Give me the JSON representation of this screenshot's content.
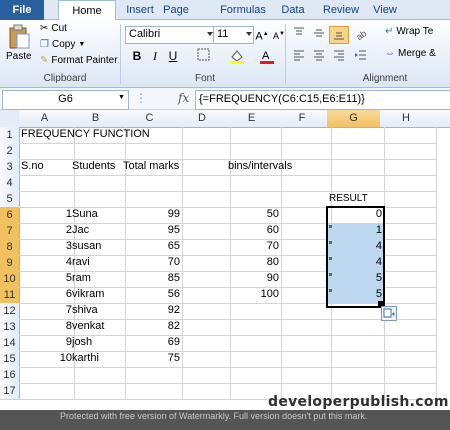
{
  "ribbon": {
    "tabs": [
      "File",
      "Home",
      "Insert",
      "Page Layout",
      "Formulas",
      "Data",
      "Review",
      "View"
    ],
    "clipboard": {
      "paste": "Paste",
      "cut": "Cut",
      "copy": "Copy",
      "format_painter": "Format Painter",
      "group": "Clipboard"
    },
    "font": {
      "name": "Calibri",
      "size": "11",
      "group": "Font"
    },
    "alignment": {
      "wrap": "Wrap Te",
      "merge": "Merge &",
      "group": "Alignment"
    }
  },
  "formula_bar": {
    "name_box": "G6",
    "fx": "fx",
    "formula": "{=FREQUENCY(C6:C15,E6:E11)}"
  },
  "columns": [
    "A",
    "B",
    "C",
    "D",
    "E",
    "F",
    "G",
    "H"
  ],
  "rows": [
    "1",
    "2",
    "3",
    "4",
    "5",
    "6",
    "7",
    "8",
    "9",
    "10",
    "11",
    "12",
    "13",
    "14",
    "15",
    "16",
    "17"
  ],
  "sheet": {
    "title": "FREQUENCY FUNCTION",
    "hdr_sno": "S.no",
    "hdr_students": "Students",
    "hdr_total": "Total marks",
    "hdr_bins": "bins/intervals",
    "result_label": "RESULT",
    "records": [
      {
        "sno": "1",
        "name": "Suna",
        "marks": "99",
        "bin": "50",
        "result": "0"
      },
      {
        "sno": "2",
        "name": "Jac",
        "marks": "95",
        "bin": "60",
        "result": "1"
      },
      {
        "sno": "3",
        "name": "susan",
        "marks": "65",
        "bin": "70",
        "result": "4"
      },
      {
        "sno": "4",
        "name": "ravi",
        "marks": "70",
        "bin": "80",
        "result": "4"
      },
      {
        "sno": "5",
        "name": "ram",
        "marks": "85",
        "bin": "90",
        "result": "5"
      },
      {
        "sno": "6",
        "name": "vikram",
        "marks": "56",
        "bin": "100",
        "result": "5"
      },
      {
        "sno": "7",
        "name": "shiva",
        "marks": "92"
      },
      {
        "sno": "8",
        "name": "venkat",
        "marks": "82"
      },
      {
        "sno": "9",
        "name": "josh",
        "marks": "69"
      },
      {
        "sno": "10",
        "name": "karthi",
        "marks": "75"
      }
    ]
  },
  "footer": {
    "logo": "developerpublish.com",
    "watermark": "Protected with free version of Watermarkly. Full version doesn't put this mark."
  }
}
